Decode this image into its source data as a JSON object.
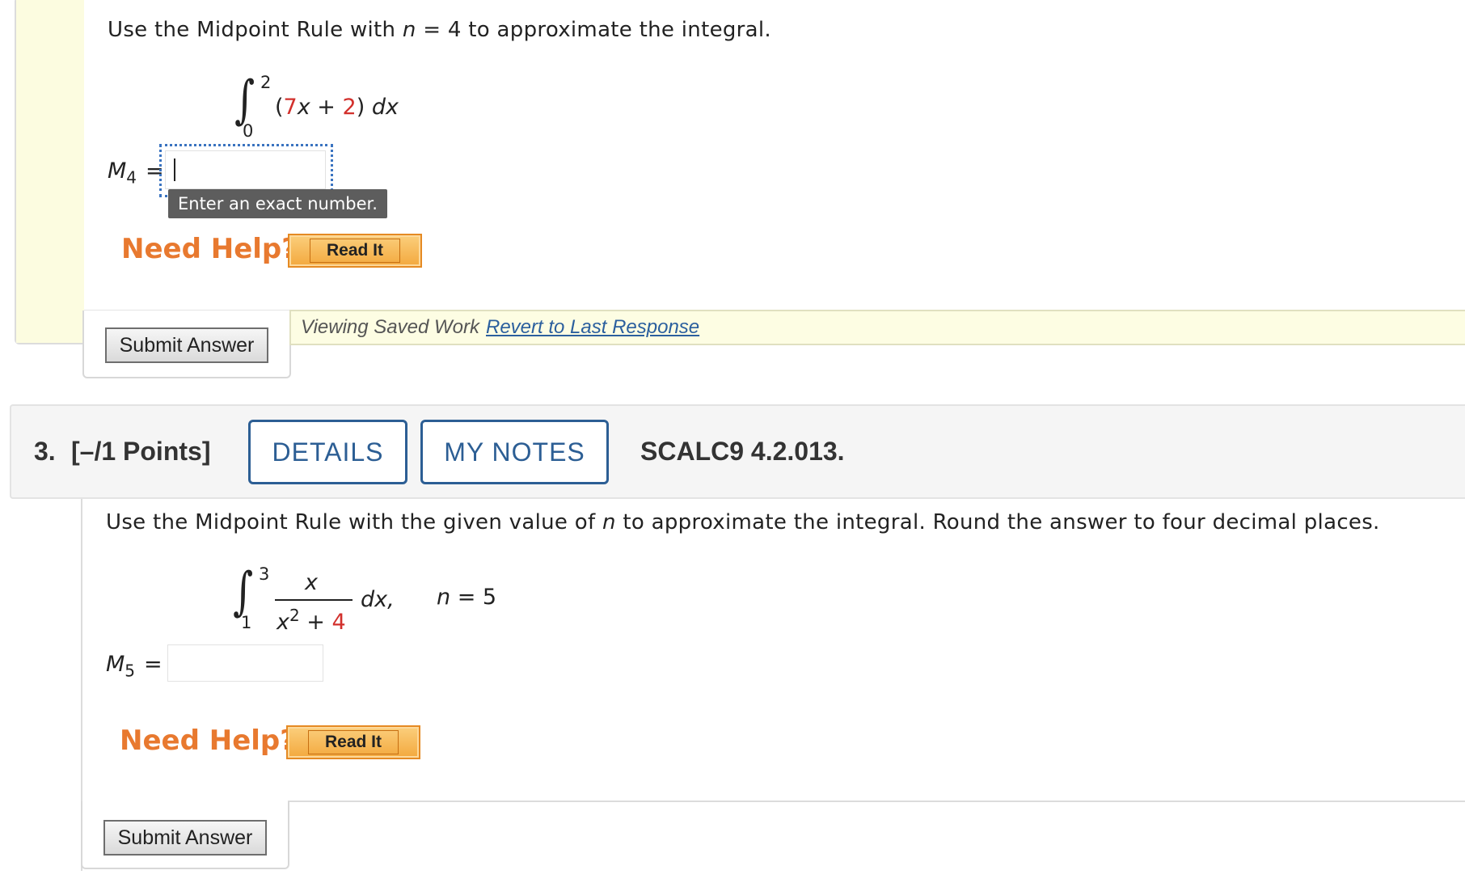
{
  "q2": {
    "prompt_pre": "Use the Midpoint Rule with ",
    "prompt_n": "n",
    "prompt_post": " = 4 to approximate the integral.",
    "integral": {
      "upper": "2",
      "lower": "0",
      "open": "(",
      "coef": "7",
      "var": "x",
      "plus": " + ",
      "const": "2",
      "close": ")",
      "dx": "dx"
    },
    "answer_label": "M",
    "answer_sub": "4",
    "equals": "=",
    "answer_value": "",
    "tooltip": "Enter an exact number.",
    "need_help": "Need Help?",
    "read_it": "Read It",
    "submit": "Submit Answer",
    "saved_text": "Viewing Saved Work",
    "revert_link": "Revert to Last Response"
  },
  "q3": {
    "number": "3.",
    "points": "[–/1 Points]",
    "details": "DETAILS",
    "my_notes": "MY NOTES",
    "code": "SCALC9 4.2.013.",
    "prompt_pre": "Use the Midpoint Rule with the given value of ",
    "prompt_n": "n",
    "prompt_post": " to approximate the integral. Round the answer to four decimal places.",
    "integral": {
      "upper": "3",
      "lower": "1",
      "numerator": "x",
      "den_var": "x",
      "den_exp": "2",
      "den_plus": " + ",
      "den_const": "4",
      "dx": "dx,",
      "n_label": "n",
      "n_value": " = 5"
    },
    "answer_label": "M",
    "answer_sub": "5",
    "equals": "=",
    "answer_value": "",
    "need_help": "Need Help?",
    "read_it": "Read It",
    "submit": "Submit Answer"
  },
  "colors": {
    "accent_blue": "#2c5e94",
    "need_help_orange": "#e8792f",
    "math_red": "#d2302c",
    "yellow_panel": "#fcfce0"
  }
}
